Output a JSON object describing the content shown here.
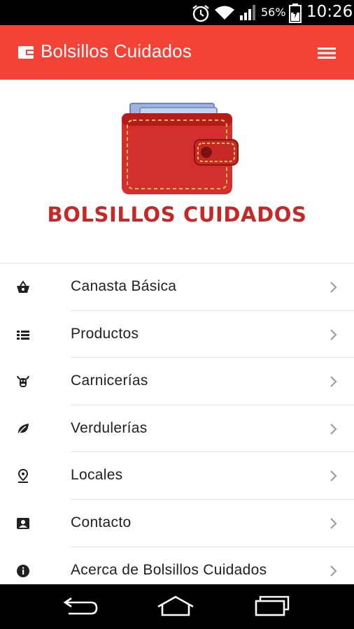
{
  "status_bar": {
    "battery_percent": "56%",
    "time": "10:26",
    "icons": [
      "alarm-icon",
      "wifi-icon",
      "signal-icon",
      "battery-charging-icon"
    ]
  },
  "app_bar": {
    "title": "Bolsillos Cuidados",
    "icon": "wallet-icon",
    "menu_icon": "hamburger-menu-icon",
    "background": "#f44336"
  },
  "hero": {
    "brand_name": "BOLSILLOS CUIDADOS",
    "brand_color": "#c62828"
  },
  "menu": {
    "items": [
      {
        "label": "Canasta Básica",
        "icon": "basket-icon"
      },
      {
        "label": "Productos",
        "icon": "list-icon"
      },
      {
        "label": "Carnicerías",
        "icon": "cow-icon"
      },
      {
        "label": "Verdulerías",
        "icon": "leaf-icon"
      },
      {
        "label": "Locales",
        "icon": "location-pin-icon"
      },
      {
        "label": "Contacto",
        "icon": "contact-card-icon"
      },
      {
        "label": "Acerca de Bolsillos Cuidados",
        "icon": "info-icon"
      }
    ]
  },
  "nav_bar": {
    "icons": [
      "back-icon",
      "home-icon",
      "recent-apps-icon"
    ]
  }
}
